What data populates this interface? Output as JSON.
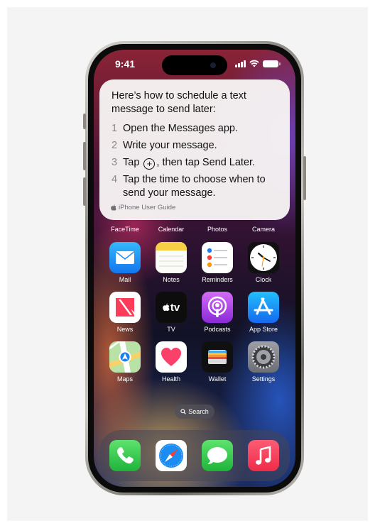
{
  "status_bar": {
    "time": "9:41"
  },
  "siri_card": {
    "title": "Here’s how to schedule a text message to send later:",
    "steps": [
      {
        "num": "1",
        "text": "Open the Messages app."
      },
      {
        "num": "2",
        "text": "Write your message."
      },
      {
        "num": "3",
        "text_before": "Tap",
        "text_after": ", then tap Send Later."
      },
      {
        "num": "4",
        "text": "Tap the time to choose when to send your message."
      }
    ],
    "source": "iPhone User Guide"
  },
  "top_row_labels": [
    "FaceTime",
    "Calendar",
    "Photos",
    "Camera"
  ],
  "apps": [
    {
      "label": "Mail"
    },
    {
      "label": "Notes"
    },
    {
      "label": "Reminders"
    },
    {
      "label": "Clock"
    },
    {
      "label": "News"
    },
    {
      "label": "TV",
      "glyph": "tv"
    },
    {
      "label": "Podcasts"
    },
    {
      "label": "App Store"
    },
    {
      "label": "Maps"
    },
    {
      "label": "Health"
    },
    {
      "label": "Wallet"
    },
    {
      "label": "Settings"
    }
  ],
  "search": {
    "label": "Search"
  },
  "dock": [
    {
      "icon": "phone-icon"
    },
    {
      "icon": "safari-icon"
    },
    {
      "icon": "messages-icon"
    },
    {
      "icon": "music-icon"
    }
  ]
}
